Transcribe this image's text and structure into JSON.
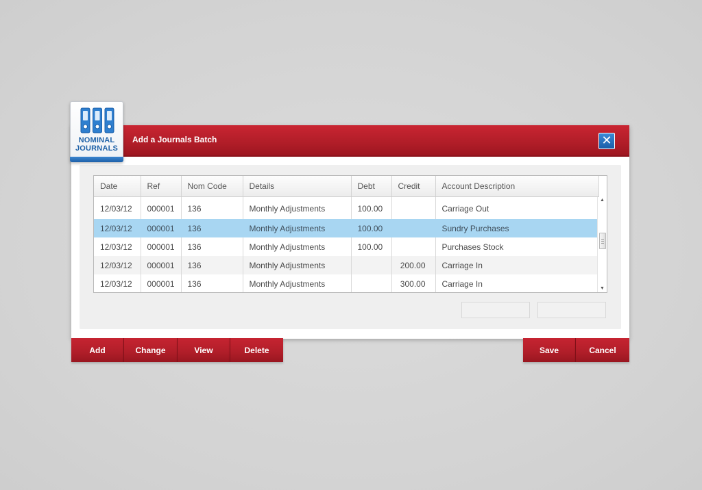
{
  "module": {
    "label_line1": "NOMINAL",
    "label_line2": "JOURNALS",
    "icon": "binders-icon"
  },
  "dialog": {
    "title": "Add a Journals Batch",
    "close_label": "✕"
  },
  "table": {
    "columns": [
      "Date",
      "Ref",
      "Nom Code",
      "Details",
      "Debt",
      "Credit",
      "Account Description"
    ],
    "rows": [
      {
        "date": "12/03/12",
        "ref": "000001",
        "nom_code": "136",
        "details": "Monthly Adjustments",
        "debt": "100.00",
        "credit": "",
        "account_description": "Carriage Out"
      },
      {
        "date": "12/03/12",
        "ref": "000001",
        "nom_code": "136",
        "details": "Monthly Adjustments",
        "debt": "100.00",
        "credit": "",
        "account_description": "Sundry Purchases"
      },
      {
        "date": "12/03/12",
        "ref": "000001",
        "nom_code": "136",
        "details": "Monthly Adjustments",
        "debt": "100.00",
        "credit": "",
        "account_description": "Purchases Stock"
      },
      {
        "date": "12/03/12",
        "ref": "000001",
        "nom_code": "136",
        "details": "Monthly Adjustments",
        "debt": "",
        "credit": "200.00",
        "account_description": "Carriage In"
      },
      {
        "date": "12/03/12",
        "ref": "000001",
        "nom_code": "136",
        "details": "Monthly Adjustments",
        "debt": "",
        "credit": "300.00",
        "account_description": "Carriage In"
      }
    ],
    "selected_row": 1
  },
  "footer": {
    "add_label": "Add",
    "change_label": "Change",
    "view_label": "View",
    "delete_label": "Delete",
    "save_label": "Save",
    "cancel_label": "Cancel"
  },
  "colors": {
    "brand_red": "#b01e29",
    "accent_blue": "#1d5fa8",
    "selection": "#a8d6f2"
  }
}
